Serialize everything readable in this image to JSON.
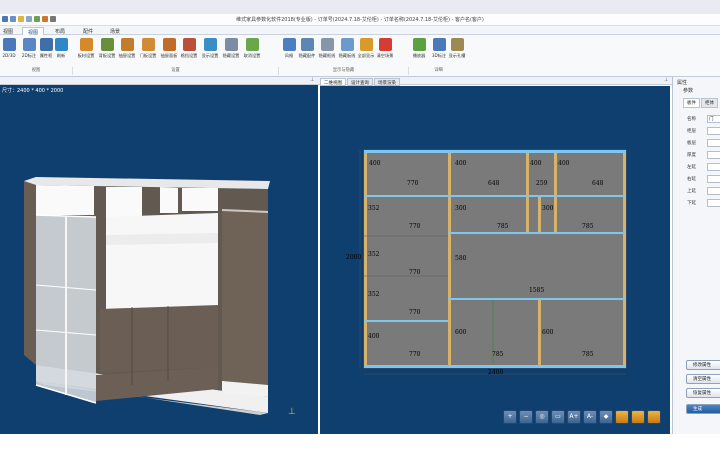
{
  "window": {
    "title": "维式家具参数化软件2018(专业版) - 订单号(2024.7.18-艾伦柜) - 订单名称(2024.7.18-艾伦柜) - 客户名(客户)"
  },
  "ribbon": {
    "tabs": [
      {
        "label": "视图"
      },
      {
        "label": "视图"
      },
      {
        "label": "布局"
      },
      {
        "label": "配件"
      },
      {
        "label": "场景"
      }
    ],
    "buttons": [
      {
        "label": "2D/3D",
        "icon": "monitor-icon",
        "color": "#4a78b8"
      },
      {
        "label": "2D标注",
        "icon": "dimension-icon",
        "color": "#5b86c4"
      },
      {
        "label": "属性框",
        "icon": "properties-icon",
        "color": "#3f6fa9"
      },
      {
        "label": "刷新",
        "icon": "refresh-icon",
        "color": "#2f87c9"
      },
      {
        "label": "板材设置",
        "icon": "board-icon",
        "color": "#d58a2a"
      },
      {
        "label": "背板设置",
        "icon": "back-panel-icon",
        "color": "#6a8f3c"
      },
      {
        "label": "抽屉设置",
        "icon": "drawer-icon",
        "color": "#c57b2c"
      },
      {
        "label": "门板设置",
        "icon": "door-icon",
        "color": "#d28b35"
      },
      {
        "label": "抽屉面板",
        "icon": "drawer-front-icon",
        "color": "#c26a2a"
      },
      {
        "label": "格挡设置",
        "icon": "shelf-icon",
        "color": "#b8503a"
      },
      {
        "label": "显示设置",
        "icon": "display-icon",
        "color": "#3b8dc6"
      },
      {
        "label": "隐藏设置",
        "icon": "grid-icon",
        "color": "#7b8da4"
      },
      {
        "label": "取消设置",
        "icon": "cancel-icon",
        "color": "#6aa64a"
      },
      {
        "label": "风格",
        "icon": "style-icon",
        "color": "#4b7fbf"
      },
      {
        "label": "隐藏配件",
        "icon": "hide-part-icon",
        "color": "#5d86b3"
      },
      {
        "label": "隐藏框线",
        "icon": "wireframe-icon",
        "color": "#8696aa"
      },
      {
        "label": "隐藏板线",
        "icon": "box-icon",
        "color": "#6b9bcc"
      },
      {
        "label": "全部显示",
        "icon": "show-all-icon",
        "color": "#d89a2b"
      },
      {
        "label": "清空场景",
        "icon": "clear-icon",
        "color": "#d63c31"
      },
      {
        "label": "播放器",
        "icon": "player-icon",
        "color": "#5aa140"
      },
      {
        "label": "3D标注",
        "icon": "3d-dimension-icon",
        "color": "#4a78b8"
      },
      {
        "label": "显示孔槽",
        "icon": "holes-icon",
        "color": "#9c8a52"
      }
    ],
    "groups": [
      {
        "label": "视图"
      },
      {
        "label": "设置"
      },
      {
        "label": "显示与隐藏"
      },
      {
        "label": "详细"
      }
    ]
  },
  "left_pane": {
    "dimensions_text": "尺寸：2400 * 400 * 2000"
  },
  "right_pane": {
    "tabs": [
      {
        "label": "二维视图"
      },
      {
        "label": "设计查询"
      },
      {
        "label": "场景渲染"
      }
    ],
    "drawing": {
      "total_width": "2400",
      "total_height": "2000",
      "labels": [
        "400",
        "770",
        "400",
        "648",
        "400",
        "259",
        "400",
        "648",
        "352",
        "770",
        "300",
        "785",
        "300",
        "785",
        "352",
        "770",
        "580",
        "1585",
        "352",
        "770",
        "400",
        "770",
        "600",
        "785",
        "600",
        "785"
      ]
    }
  },
  "props": {
    "header": "属性",
    "subheader": "参数",
    "tabs": [
      {
        "label": "板件"
      },
      {
        "label": "柜体"
      }
    ],
    "rows": [
      {
        "key": "名称",
        "value": "门"
      },
      {
        "key": "柜层",
        "value": ""
      },
      {
        "key": "板层",
        "value": ""
      },
      {
        "key": "厚度",
        "value": ""
      },
      {
        "key": "左延",
        "value": ""
      },
      {
        "key": "右延",
        "value": ""
      },
      {
        "key": "上延",
        "value": ""
      },
      {
        "key": "下延",
        "value": ""
      }
    ],
    "buttons": [
      {
        "label": "修改属性"
      },
      {
        "label": "清空属性"
      },
      {
        "label": "恢复属性"
      },
      {
        "label": "生成"
      }
    ]
  },
  "toolbar": {
    "zoom_in": "+",
    "zoom_out": "−",
    "zoom_fit": "◎",
    "buttons": [
      "▭",
      "A+",
      "A-",
      "◆",
      "🔒",
      "🔒",
      "🔒"
    ]
  },
  "colors": {
    "viewport_bg": "#0f3f6e",
    "panel_fill": "#7a7a7a",
    "board_edge": "#d6b26a",
    "shelf_blue": "#7fc6ef"
  }
}
